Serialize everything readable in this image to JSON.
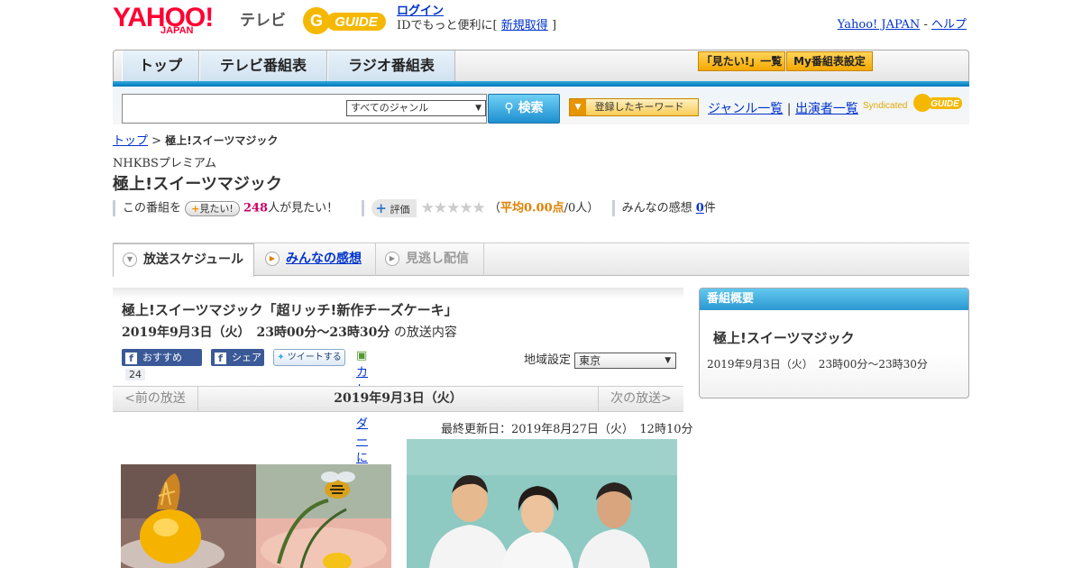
{
  "header": {
    "logo_yahoo": "YAHOO!",
    "logo_japan": "JAPAN",
    "logo_tv": "テレビ",
    "gguide": "GUIDE",
    "login_link": "ログイン",
    "login_text": "IDでもっと便利に[",
    "signup_link": "新規取得",
    "login_text_end": "]",
    "yahoo_japan_link": "Yahoo! JAPAN",
    "sep": "-",
    "help_link": "ヘルプ"
  },
  "nav": {
    "tabs": [
      {
        "label": "トップ"
      },
      {
        "label": "テレビ番組表"
      },
      {
        "label": "ラジオ番組表"
      }
    ],
    "mitai_list": "「見たい!」一覧",
    "my_schedule": "My番組表設定"
  },
  "search": {
    "genre": "すべてのジャンル",
    "button": "検索",
    "keyword_button": "登録したキーワード",
    "genre_list_link": "ジャンル一覧",
    "divider": "|",
    "cast_list_link": "出演者一覧",
    "syndicated": "Syndicated"
  },
  "breadcrumb": {
    "top": "トップ",
    "sep": ">",
    "current": "極上!スイーツマジック"
  },
  "program": {
    "station": "NHKBSプレミアム",
    "title": "極上!スイーツマジック",
    "this_program": "この番組を",
    "mitai_button": "見たい!",
    "mitai_count": "248",
    "mitai_suffix": "人が見たい！",
    "rate_button": "評価",
    "rating": 0,
    "stars": "★★★★★",
    "avg_open": "（",
    "avg_label": "平均0.00点",
    "avg_count": "/0人）",
    "impressions_label": "みんなの感想",
    "impressions_count": "0",
    "impressions_suffix": "件"
  },
  "subtabs": {
    "schedule": "放送スケジュール",
    "impressions": "みんなの感想",
    "vod": "見逃し配信"
  },
  "episode": {
    "title": "極上!スイーツマジック「超リッチ!新作チーズケーキ」",
    "datetime": "2019年9月3日（火）　23時00分～23時30分",
    "datetime_suffix": "の放送内容",
    "fb_recommend": "おすすめ",
    "fb_count": "24",
    "fb_share": "シェア",
    "tweet": "ツイートする",
    "calendar": "カレンダーに登録",
    "region_label": "地域設定",
    "region_value": "東京",
    "prev": "<前の放送",
    "date": "2019年9月3日（火）",
    "next": "次の放送>",
    "updated": "最終更新日：2019年8月27日（火）　12時10分"
  },
  "sidebar": {
    "header": "番組概要",
    "title": "極上!スイーツマジック",
    "time": "2019年9月3日（火）　23時00分～23時30分"
  },
  "colors": {
    "yahoo_red": "#ff0033",
    "nav_blue": "#0077bb",
    "link": "#0033cc",
    "count_red": "#cc0066",
    "rating_orange": "#e08000",
    "gguide_yellow": "#f5b800"
  }
}
